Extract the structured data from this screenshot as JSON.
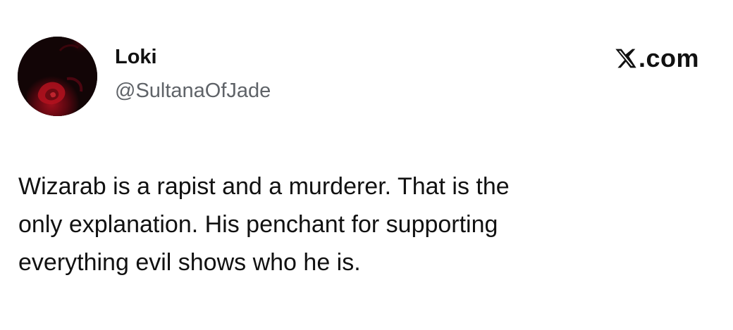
{
  "author": {
    "name": "Loki",
    "handle": "@SultanaOfJade",
    "avatar_icon": "dark-red-rose-avatar"
  },
  "brand": {
    "text": ".com",
    "icon": "x-logo-icon"
  },
  "post": {
    "lines": [
      "Wizarab is a rapist and a murderer. That is the",
      "only explanation. His penchant for supporting",
      "everything evil shows who he is."
    ]
  },
  "colors": {
    "background": "#ffffff",
    "text": "#111111",
    "handle": "#5f6368",
    "avatar_dark": "#120506",
    "avatar_red": "#8b0a14"
  }
}
